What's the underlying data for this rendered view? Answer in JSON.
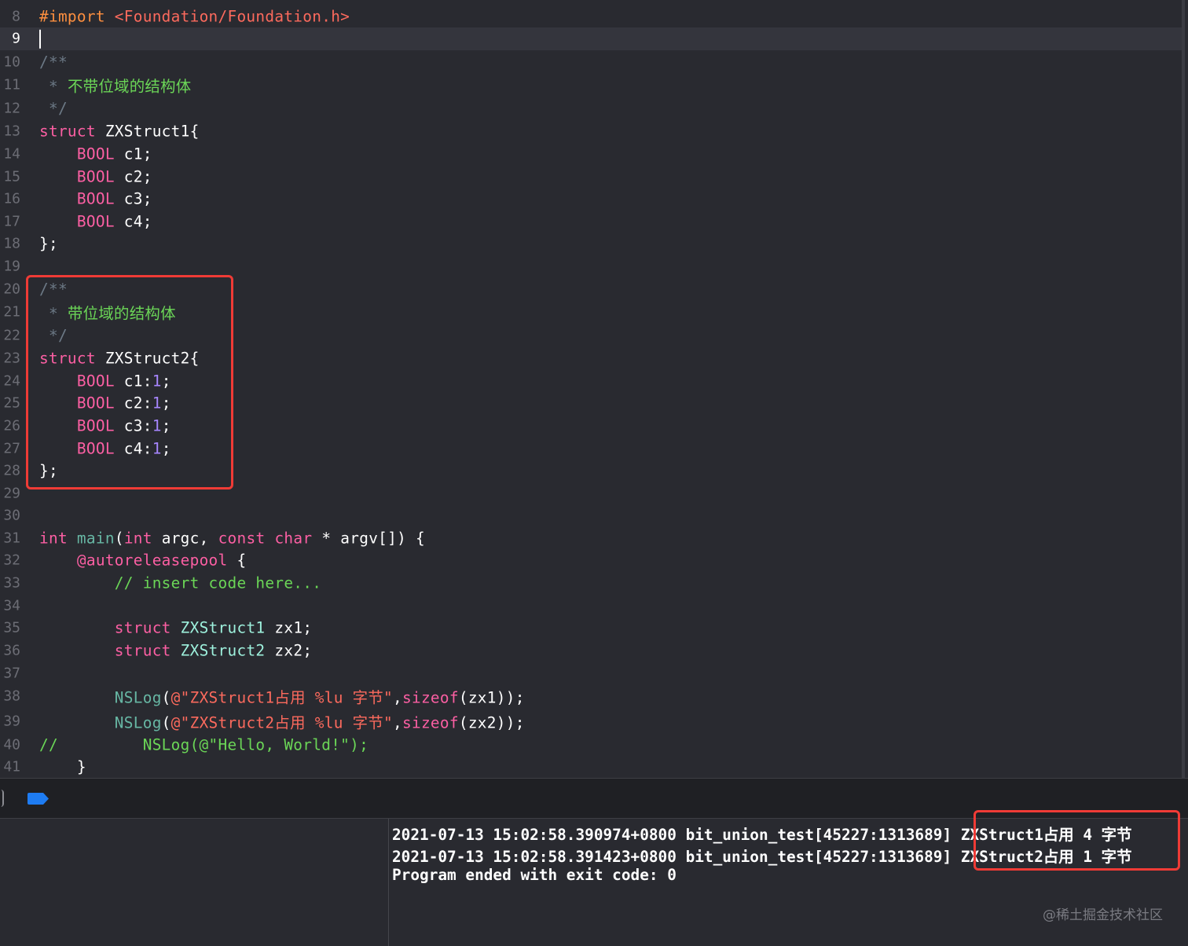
{
  "colors": {
    "background": "#292a30",
    "keyword": "#fc5fa3",
    "string": "#fc6a5d",
    "comment": "#6c7986",
    "comment_text": "#6bd657",
    "number": "#a786ff",
    "type": "#d0a8ff",
    "project_type": "#9ef1dd",
    "plain": "#ffffff",
    "highlight_border": "#ef3b36"
  },
  "editor": {
    "lines": [
      {
        "num": "8",
        "tokens": [
          {
            "t": "#import ",
            "c": "preproc"
          },
          {
            "t": "<Foundation/Foundation.h>",
            "c": "string"
          }
        ]
      },
      {
        "num": "9",
        "current": true,
        "caret": true,
        "tokens": []
      },
      {
        "num": "10",
        "tokens": [
          {
            "t": "/**",
            "c": "comment"
          }
        ]
      },
      {
        "num": "11",
        "tokens": [
          {
            "t": " * ",
            "c": "comment"
          },
          {
            "t": "不带位域的结构体",
            "c": "doc",
            "cjk": true
          }
        ]
      },
      {
        "num": "12",
        "tokens": [
          {
            "t": " */",
            "c": "comment"
          }
        ]
      },
      {
        "num": "13",
        "tokens": [
          {
            "t": "struct",
            "c": "keyword"
          },
          {
            "t": " ZXStruct1{",
            "c": "plain"
          }
        ]
      },
      {
        "num": "14",
        "tokens": [
          {
            "t": "    ",
            "c": "plain"
          },
          {
            "t": "BOOL",
            "c": "keyword"
          },
          {
            "t": " c1;",
            "c": "plain"
          }
        ]
      },
      {
        "num": "15",
        "tokens": [
          {
            "t": "    ",
            "c": "plain"
          },
          {
            "t": "BOOL",
            "c": "keyword"
          },
          {
            "t": " c2;",
            "c": "plain"
          }
        ]
      },
      {
        "num": "16",
        "tokens": [
          {
            "t": "    ",
            "c": "plain"
          },
          {
            "t": "BOOL",
            "c": "keyword"
          },
          {
            "t": " c3;",
            "c": "plain"
          }
        ]
      },
      {
        "num": "17",
        "tokens": [
          {
            "t": "    ",
            "c": "plain"
          },
          {
            "t": "BOOL",
            "c": "keyword"
          },
          {
            "t": " c4;",
            "c": "plain"
          }
        ]
      },
      {
        "num": "18",
        "tokens": [
          {
            "t": "};",
            "c": "plain"
          }
        ]
      },
      {
        "num": "19",
        "tokens": []
      },
      {
        "num": "20",
        "tokens": [
          {
            "t": "/**",
            "c": "comment"
          }
        ]
      },
      {
        "num": "21",
        "tokens": [
          {
            "t": " * ",
            "c": "comment"
          },
          {
            "t": "带位域的结构体",
            "c": "doc",
            "cjk": true
          }
        ]
      },
      {
        "num": "22",
        "tokens": [
          {
            "t": " */",
            "c": "comment"
          }
        ]
      },
      {
        "num": "23",
        "tokens": [
          {
            "t": "struct",
            "c": "keyword"
          },
          {
            "t": " ZXStruct2{",
            "c": "plain"
          }
        ]
      },
      {
        "num": "24",
        "tokens": [
          {
            "t": "    ",
            "c": "plain"
          },
          {
            "t": "BOOL",
            "c": "keyword"
          },
          {
            "t": " c1:",
            "c": "plain"
          },
          {
            "t": "1",
            "c": "number"
          },
          {
            "t": ";",
            "c": "plain"
          }
        ]
      },
      {
        "num": "25",
        "tokens": [
          {
            "t": "    ",
            "c": "plain"
          },
          {
            "t": "BOOL",
            "c": "keyword"
          },
          {
            "t": " c2:",
            "c": "plain"
          },
          {
            "t": "1",
            "c": "number"
          },
          {
            "t": ";",
            "c": "plain"
          }
        ]
      },
      {
        "num": "26",
        "tokens": [
          {
            "t": "    ",
            "c": "plain"
          },
          {
            "t": "BOOL",
            "c": "keyword"
          },
          {
            "t": " c3:",
            "c": "plain"
          },
          {
            "t": "1",
            "c": "number"
          },
          {
            "t": ";",
            "c": "plain"
          }
        ]
      },
      {
        "num": "27",
        "tokens": [
          {
            "t": "    ",
            "c": "plain"
          },
          {
            "t": "BOOL",
            "c": "keyword"
          },
          {
            "t": " c4:",
            "c": "plain"
          },
          {
            "t": "1",
            "c": "number"
          },
          {
            "t": ";",
            "c": "plain"
          }
        ]
      },
      {
        "num": "28",
        "tokens": [
          {
            "t": "};",
            "c": "plain"
          }
        ]
      },
      {
        "num": "29",
        "tokens": []
      },
      {
        "num": "30",
        "tokens": []
      },
      {
        "num": "31",
        "tokens": [
          {
            "t": "int",
            "c": "keyword"
          },
          {
            "t": " ",
            "c": "plain"
          },
          {
            "t": "main",
            "c": "func"
          },
          {
            "t": "(",
            "c": "plain"
          },
          {
            "t": "int",
            "c": "keyword"
          },
          {
            "t": " argc, ",
            "c": "plain"
          },
          {
            "t": "const",
            "c": "keyword"
          },
          {
            "t": " ",
            "c": "plain"
          },
          {
            "t": "char",
            "c": "keyword"
          },
          {
            "t": " * argv[]) {",
            "c": "plain"
          }
        ]
      },
      {
        "num": "32",
        "tokens": [
          {
            "t": "    ",
            "c": "plain"
          },
          {
            "t": "@autoreleasepool",
            "c": "keyword"
          },
          {
            "t": " {",
            "c": "plain"
          }
        ]
      },
      {
        "num": "33",
        "tokens": [
          {
            "t": "        ",
            "c": "plain"
          },
          {
            "t": "// insert code here...",
            "c": "line-comment"
          }
        ]
      },
      {
        "num": "34",
        "tokens": []
      },
      {
        "num": "35",
        "tokens": [
          {
            "t": "        ",
            "c": "plain"
          },
          {
            "t": "struct",
            "c": "keyword"
          },
          {
            "t": " ",
            "c": "plain"
          },
          {
            "t": "ZXStruct1",
            "c": "project"
          },
          {
            "t": " zx1;",
            "c": "plain"
          }
        ]
      },
      {
        "num": "36",
        "tokens": [
          {
            "t": "        ",
            "c": "plain"
          },
          {
            "t": "struct",
            "c": "keyword"
          },
          {
            "t": " ",
            "c": "plain"
          },
          {
            "t": "ZXStruct2",
            "c": "project"
          },
          {
            "t": " zx2;",
            "c": "plain"
          }
        ]
      },
      {
        "num": "37",
        "tokens": []
      },
      {
        "num": "38",
        "tokens": [
          {
            "t": "        ",
            "c": "plain"
          },
          {
            "t": "NSLog",
            "c": "func"
          },
          {
            "t": "(",
            "c": "plain"
          },
          {
            "t": "@\"ZXStruct1",
            "c": "string"
          },
          {
            "t": "占用",
            "c": "string",
            "cjk": true
          },
          {
            "t": " %lu ",
            "c": "string"
          },
          {
            "t": "字节",
            "c": "string",
            "cjk": true
          },
          {
            "t": "\"",
            "c": "string"
          },
          {
            "t": ",",
            "c": "plain"
          },
          {
            "t": "sizeof",
            "c": "keyword"
          },
          {
            "t": "(zx1));",
            "c": "plain"
          }
        ]
      },
      {
        "num": "39",
        "tokens": [
          {
            "t": "        ",
            "c": "plain"
          },
          {
            "t": "NSLog",
            "c": "func"
          },
          {
            "t": "(",
            "c": "plain"
          },
          {
            "t": "@\"ZXStruct2",
            "c": "string"
          },
          {
            "t": "占用",
            "c": "string",
            "cjk": true
          },
          {
            "t": " %lu ",
            "c": "string"
          },
          {
            "t": "字节",
            "c": "string",
            "cjk": true
          },
          {
            "t": "\"",
            "c": "string"
          },
          {
            "t": ",",
            "c": "plain"
          },
          {
            "t": "sizeof",
            "c": "keyword"
          },
          {
            "t": "(zx2));",
            "c": "plain"
          }
        ]
      },
      {
        "num": "40",
        "tokens": [
          {
            "t": "//         NSLog(@\"Hello, World!\");",
            "c": "line-comment"
          }
        ]
      },
      {
        "num": "41",
        "tokens": [
          {
            "t": "    }",
            "c": "plain"
          }
        ]
      }
    ]
  },
  "debug_bar": {
    "breakpoint_icon": "breakpoint-toggle-icon"
  },
  "console": {
    "lines": [
      {
        "prefix": "2021-07-13 15:02:58.390974+0800 bit_union_test[45227:1313689] ",
        "message": "ZXStruct1占用 4 字节"
      },
      {
        "prefix": "2021-07-13 15:02:58.391423+0800 bit_union_test[45227:1313689] ",
        "message": "ZXStruct2占用 1 字节"
      },
      {
        "prefix": "Program ended with exit code: 0",
        "message": ""
      }
    ]
  },
  "watermark": "@稀土掘金技术社区"
}
